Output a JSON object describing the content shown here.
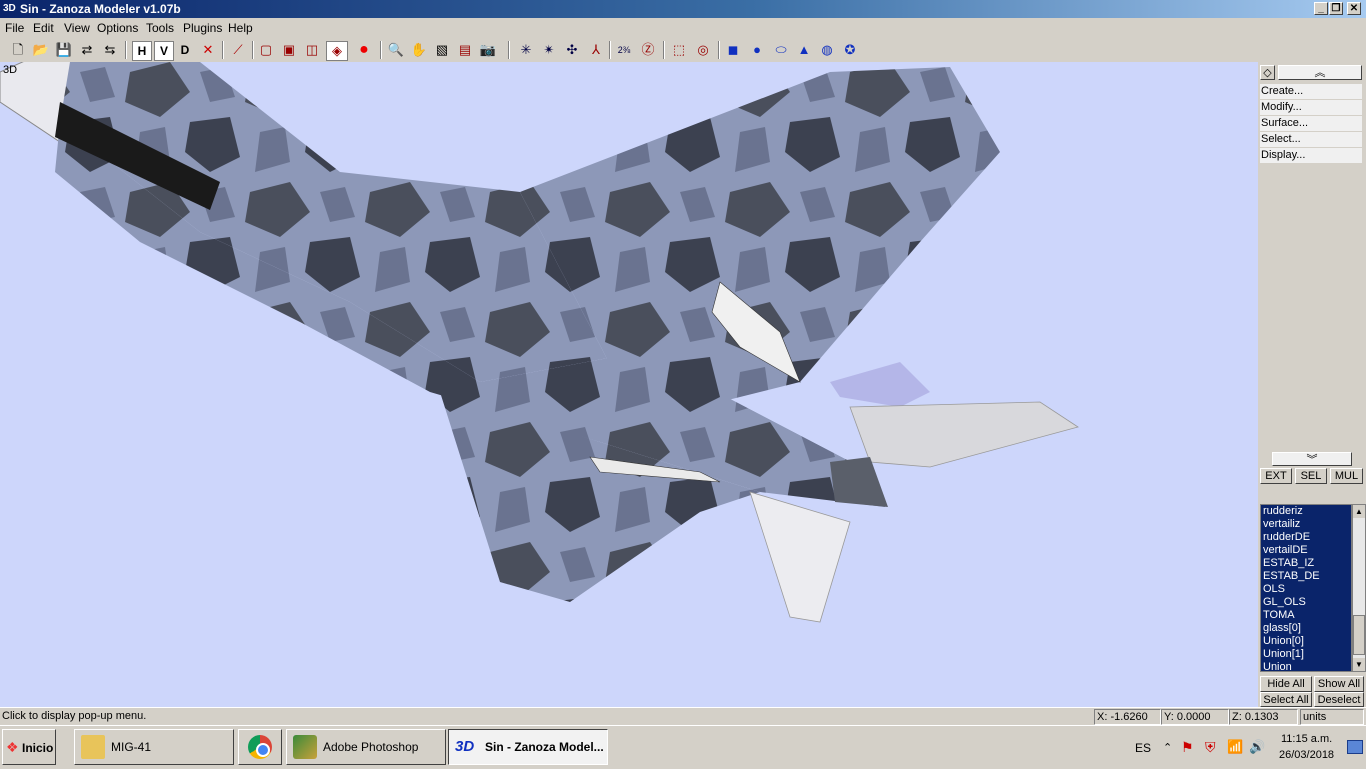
{
  "window": {
    "title": "Sin - Zanoza Modeler v1.07b",
    "app_icon": "3D"
  },
  "window_controls": {
    "minimize": "_",
    "maximize": "❐",
    "close": "✕"
  },
  "menu": [
    "File",
    "Edit",
    "View",
    "Options",
    "Tools",
    "Plugins",
    "Help"
  ],
  "toolbar": {
    "view_buttons": [
      "H",
      "V",
      "D"
    ]
  },
  "viewport": {
    "label": "3D",
    "background": "#cdd6fb"
  },
  "panel": {
    "up_arrow": "︽",
    "down_arrow": "︾",
    "menu_items": [
      "Create...",
      "Modify...",
      "Surface...",
      "Select...",
      "Display..."
    ],
    "mode_buttons": [
      "EXT",
      "SEL",
      "MUL"
    ],
    "objects": [
      "rudderiz",
      "vertailiz",
      "rudderDE",
      "vertailDE",
      "ESTAB_IZ",
      "ESTAB_DE",
      "OLS",
      "GL_OLS",
      "TOMA",
      "glass[0]",
      "Union[0]",
      "Union[1]",
      "Union"
    ],
    "hide_all": "Hide All",
    "show_all": "Show All",
    "select_all": "Select All",
    "deselect": "Deselect"
  },
  "status": {
    "message": "Click to display pop-up menu.",
    "x": "X: -1.6260",
    "y": "Y: 0.0000",
    "z": "Z: 0.1303",
    "units": "units"
  },
  "taskbar": {
    "start": "Inicio",
    "tasks": [
      {
        "label": "MIG-41",
        "icon": "folder-icon"
      },
      {
        "label": "",
        "icon": "chrome-icon"
      },
      {
        "label": "Adobe Photoshop",
        "icon": "photoshop-icon"
      },
      {
        "label": "Sin - Zanoza Model...",
        "icon": "zanoza-3d-icon"
      }
    ],
    "language": "ES",
    "time": "11:15 a.m.",
    "date": "26/03/2018"
  }
}
